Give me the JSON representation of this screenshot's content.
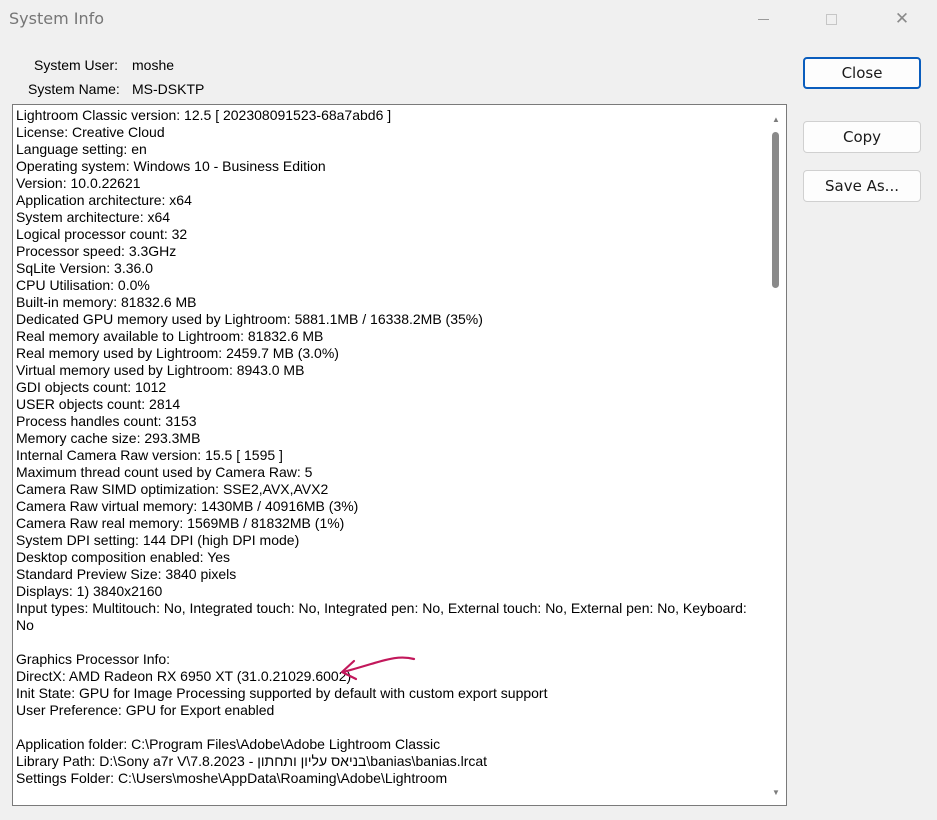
{
  "window": {
    "title": "System Info",
    "icons": {
      "minimize": "minimize-icon",
      "maximize": "maximize-icon",
      "close": "close-icon"
    },
    "close_glyph": "✕"
  },
  "info": {
    "user_label": "System User:",
    "user_value": "moshe",
    "name_label": "System Name:",
    "name_value": "MS-DSKTP"
  },
  "buttons": {
    "close": "Close",
    "copy": "Copy",
    "save_as": "Save As..."
  },
  "log_lines": [
    "Lightroom Classic version: 12.5 [ 202308091523-68a7abd6 ]",
    "License: Creative Cloud",
    "Language setting: en",
    "Operating system: Windows 10 - Business Edition",
    "Version: 10.0.22621",
    "Application architecture: x64",
    "System architecture: x64",
    "Logical processor count: 32",
    "Processor speed: 3.3GHz",
    "SqLite Version: 3.36.0",
    "CPU Utilisation: 0.0%",
    "Built-in memory: 81832.6 MB",
    "Dedicated GPU memory used by Lightroom: 5881.1MB / 16338.2MB (35%)",
    "Real memory available to Lightroom: 81832.6 MB",
    "Real memory used by Lightroom: 2459.7 MB (3.0%)",
    "Virtual memory used by Lightroom: 8943.0 MB",
    "GDI objects count: 1012",
    "USER objects count: 2814",
    "Process handles count: 3153",
    "Memory cache size: 293.3MB",
    "Internal Camera Raw version: 15.5 [ 1595 ]",
    "Maximum thread count used by Camera Raw: 5",
    "Camera Raw SIMD optimization: SSE2,AVX,AVX2",
    "Camera Raw virtual memory: 1430MB / 40916MB (3%)",
    "Camera Raw real memory: 1569MB / 81832MB (1%)",
    "System DPI setting: 144 DPI (high DPI mode)",
    "Desktop composition enabled: Yes",
    "Standard Preview Size: 3840 pixels",
    "Displays: 1) 3840x2160",
    "Input types: Multitouch: No, Integrated touch: No, Integrated pen: No, External touch: No, External pen: No, Keyboard:",
    "No",
    "",
    "Graphics Processor Info:",
    "DirectX: AMD Radeon RX 6950 XT (31.0.21029.6002)",
    "Init State: GPU for Image Processing supported by default with custom export support",
    "User Preference: GPU for Export enabled",
    "",
    "Application folder: C:\\Program Files\\Adobe\\Adobe Lightroom Classic",
    "Library Path: D:\\Sony a7r V\\7.8.2023 - בניאס עליון ותחתון\\banias\\banias.lrcat",
    "Settings Folder: C:\\Users\\moshe\\AppData\\Roaming\\Adobe\\Lightroom"
  ],
  "scrollbar": {
    "thumb_position": 0.0,
    "up_glyph": "▲",
    "down_glyph": "▼"
  },
  "annotation": {
    "icon": "arrow-annotation-icon",
    "color": "#c2185b"
  }
}
